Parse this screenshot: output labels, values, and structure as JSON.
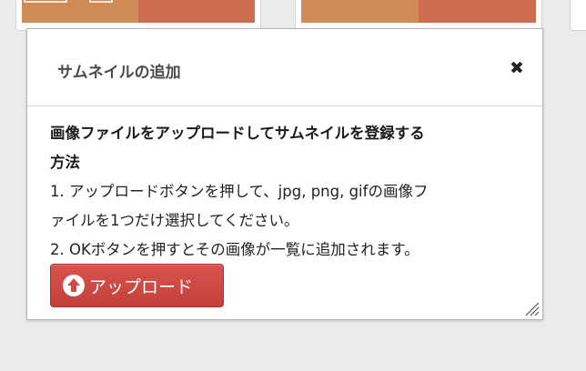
{
  "background_cards": {
    "accent_left": "#cf8a55",
    "accent_right": "#cf6c4f"
  },
  "dialog": {
    "title": "サムネイルの追加",
    "close_icon": "close-icon",
    "heading_line1": "画像ファイルをアップロードしてサムネイルを登録する",
    "heading_line2": "方法",
    "step1_line1": "1. アップロードボタンを押して、jpg, png, gifの画像フ",
    "step1_line2": "ァイルを1つだけ選択してください。",
    "step2": "2. OKボタンを押すとその画像が一覧に追加されます。",
    "upload_button_label": "アップロード",
    "upload_icon": "upload-arrow-icon",
    "button_color": "#d14a45"
  }
}
